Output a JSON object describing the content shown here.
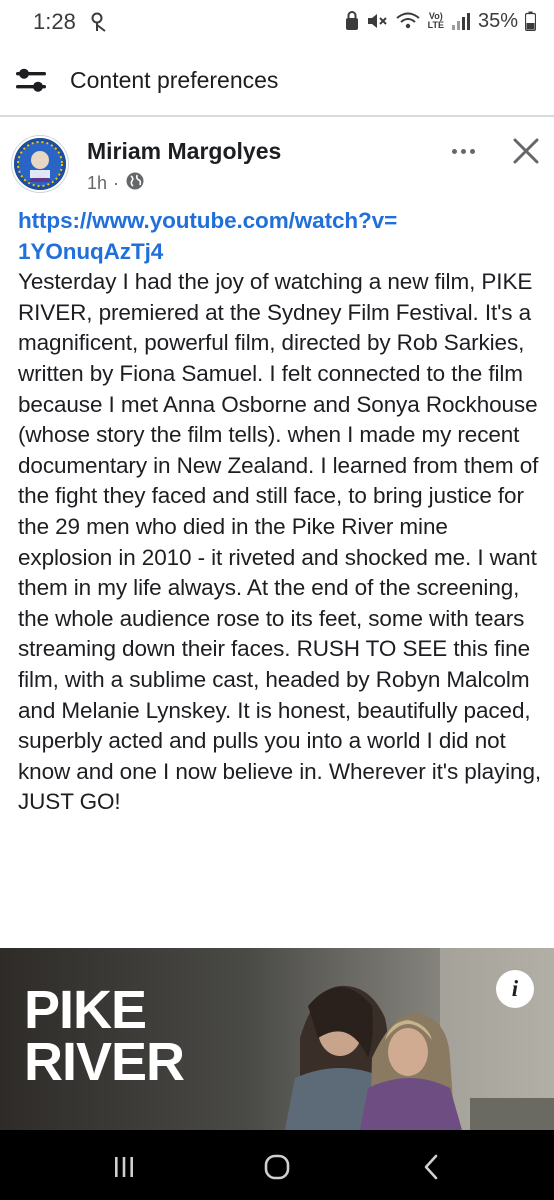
{
  "status_bar": {
    "time": "1:28",
    "battery": "35%",
    "icons": [
      "recording-icon",
      "lock-icon",
      "mute-icon",
      "wifi-icon",
      "volte-icon",
      "signal-icon",
      "battery-icon"
    ],
    "volte_label_top": "Vo)",
    "volte_label_bottom": "LTE"
  },
  "header": {
    "title": "Content preferences",
    "icon": "sliders-icon"
  },
  "post": {
    "author": "Miriam Margolyes",
    "time_ago": "1h",
    "separator": "·",
    "audience_icon": "globe-icon",
    "link": "https://www.youtube.com/watch?v=\n1YOnuqAzTj4",
    "text": "Yesterday I had the joy of watching a new film, PIKE RIVER, premiered at the Sydney Film Festival. It's a magnificent, powerful film, directed by Rob Sarkies, written by Fiona Samuel.  I felt connected to the film because I met Anna Osborne and Sonya Rockhouse (whose story the film tells). when I made my recent documentary in New Zealand.  I learned from them of the fight they faced and still face, to bring justice for the 29 men who died in the Pike River mine explosion in 2010 - it riveted and shocked me.  I want them in my life always. At the end of the screening, the whole audience rose to its feet, some with tears streaming down their faces. RUSH TO SEE this fine film, with a sublime cast, headed by Robyn Malcolm and Melanie Lynskey. It is honest, beautifully paced, superbly acted and pulls you into a world I did not know and one I now believe in. Wherever it's playing, JUST GO!"
  },
  "media": {
    "title_line1": "PIKE",
    "title_line2": "RIVER",
    "info_label": "i"
  },
  "nav_bar": {
    "items": [
      "recents-icon",
      "home-icon",
      "back-icon"
    ]
  },
  "colors": {
    "link": "#216fdb",
    "text": "#1c1e21",
    "secondary_text": "#65676b",
    "divider": "#d6d9dd",
    "nav_background": "#000000"
  }
}
